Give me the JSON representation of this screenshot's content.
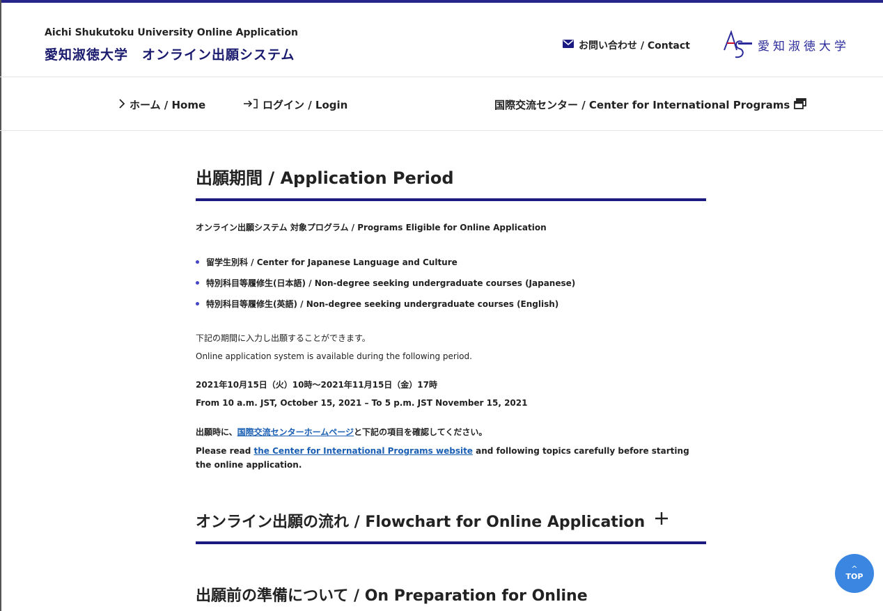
{
  "header": {
    "system_name_en": "Aichi Shukutoku University Online Application",
    "system_name_ja": "愛知淑徳大学　オンライン出願システム",
    "contact_label": "お問い合わせ / Contact",
    "logo_text": "愛知淑徳大学"
  },
  "nav": {
    "home_label": "ホーム / Home",
    "login_label": "ログイン / Login",
    "cip_label": "国際交流センター / Center for International Programs"
  },
  "main": {
    "title": "出願期間 / Application Period",
    "programs_heading": "オンライン出願システム 対象プログラム / Programs Eligible for Online Application",
    "programs": [
      "留学生別科 / Center for Japanese Language and Culture",
      "特別科目等履修生(日本語) / Non-degree seeking undergraduate courses (Japanese)",
      "特別科目等履修生(英語) / Non-degree seeking undergraduate courses (English)"
    ],
    "availability_ja": "下記の期間に入力し出願することができます。",
    "availability_en": "Online application system is available during the following period.",
    "period_ja": "2021年10月15日（火）10時～2021年11月15日（金）17時",
    "period_en": "From 10 a.m. JST, October 15, 2021 – To 5 p.m. JST November 15, 2021",
    "confirm_ja_prefix": "出願時に、",
    "confirm_ja_link": "国際交流センターホームページ",
    "confirm_ja_suffix": "と下記の項目を確認してください。",
    "confirm_en_prefix": "Please read ",
    "confirm_en_link": "the Center for International Programs website",
    "confirm_en_suffix": " and following topics carefully before starting the online application.",
    "flowchart_title": "オンライン出願の流れ / Flowchart for Online Application",
    "preparation_title": "出願前の準備について / On Preparation for Online"
  },
  "top_button": {
    "arrow": "^",
    "label": "TOP"
  },
  "colors": {
    "accent": "#1a1a80",
    "bullet": "#4545c8",
    "link": "#1a5fb4",
    "top_button": "#3a86e0"
  }
}
